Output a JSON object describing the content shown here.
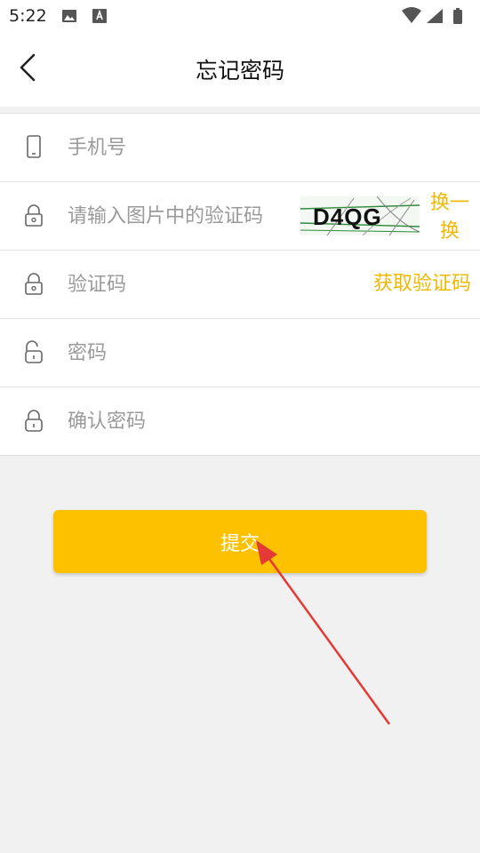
{
  "status_bar": {
    "time": "5:22"
  },
  "header": {
    "title": "忘记密码"
  },
  "form": {
    "phone": {
      "placeholder": "手机号"
    },
    "image_code": {
      "placeholder": "请输入图片中的验证码",
      "captcha_text": "D4QG",
      "refresh_label": "换一换"
    },
    "sms_code": {
      "placeholder": "验证码",
      "get_code_label": "获取验证码"
    },
    "password": {
      "placeholder": "密码"
    },
    "confirm_password": {
      "placeholder": "确认密码"
    }
  },
  "submit": {
    "label": "提交"
  },
  "colors": {
    "accent": "#fdc100",
    "link": "#f1b800",
    "background": "#f1f1f1",
    "annotation": "#e53935"
  },
  "icons": [
    "back-arrow-icon",
    "phone-icon",
    "lock-icon",
    "unlock-icon"
  ]
}
